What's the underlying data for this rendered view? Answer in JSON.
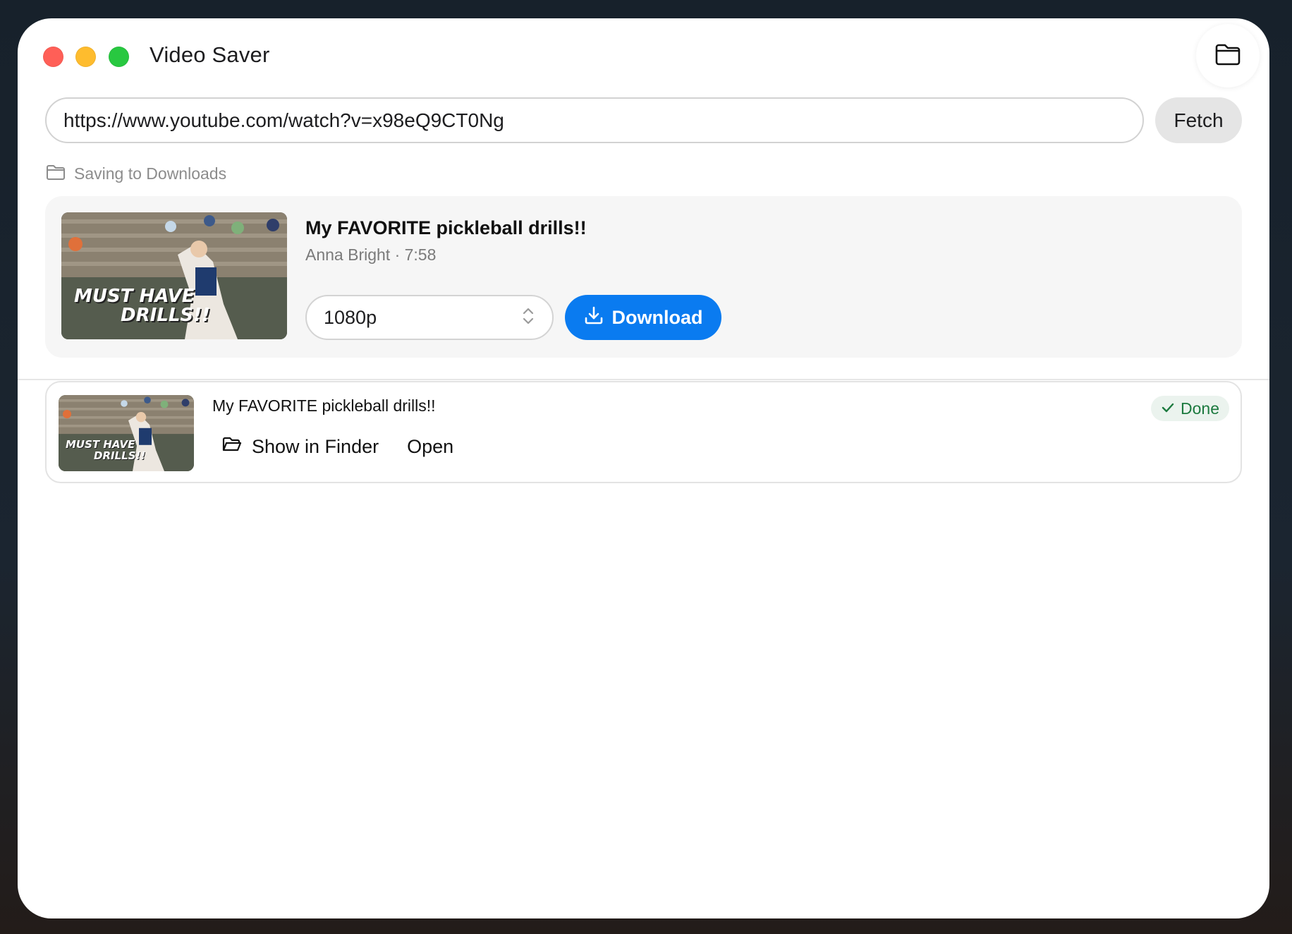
{
  "window": {
    "title": "Video Saver"
  },
  "url_bar": {
    "value": "https://www.youtube.com/watch?v=x98eQ9CT0Ng",
    "fetch_label": "Fetch"
  },
  "save_location": {
    "text": "Saving to Downloads"
  },
  "current_video": {
    "title": "My FAVORITE pickleball drills!!",
    "meta": "Anna Bright · 7:58",
    "thumbnail_text_line1": "MUST HAVE",
    "thumbnail_text_line2": "DRILLS!!",
    "quality": "1080p",
    "download_label": "Download"
  },
  "history": [
    {
      "title": "My FAVORITE pickleball drills!!",
      "thumbnail_text_line1": "MUST HAVE",
      "thumbnail_text_line2": "DRILLS!!",
      "show_in_finder_label": "Show in Finder",
      "open_label": "Open",
      "status": "Done"
    }
  ],
  "colors": {
    "accent": "#0a7bf0",
    "done_text": "#1c7a3f",
    "done_bg": "#ebf3ee",
    "close": "#ff5f57",
    "minimize": "#febc2e",
    "maximize": "#28c840"
  },
  "icons": {
    "titlebar_folder": "folder-icon",
    "save_location": "folder-outline-icon",
    "quality_stepper": "chevron-up-down-icon",
    "download": "download-icon",
    "finder": "folder-open-icon",
    "done": "checkmark-icon"
  }
}
